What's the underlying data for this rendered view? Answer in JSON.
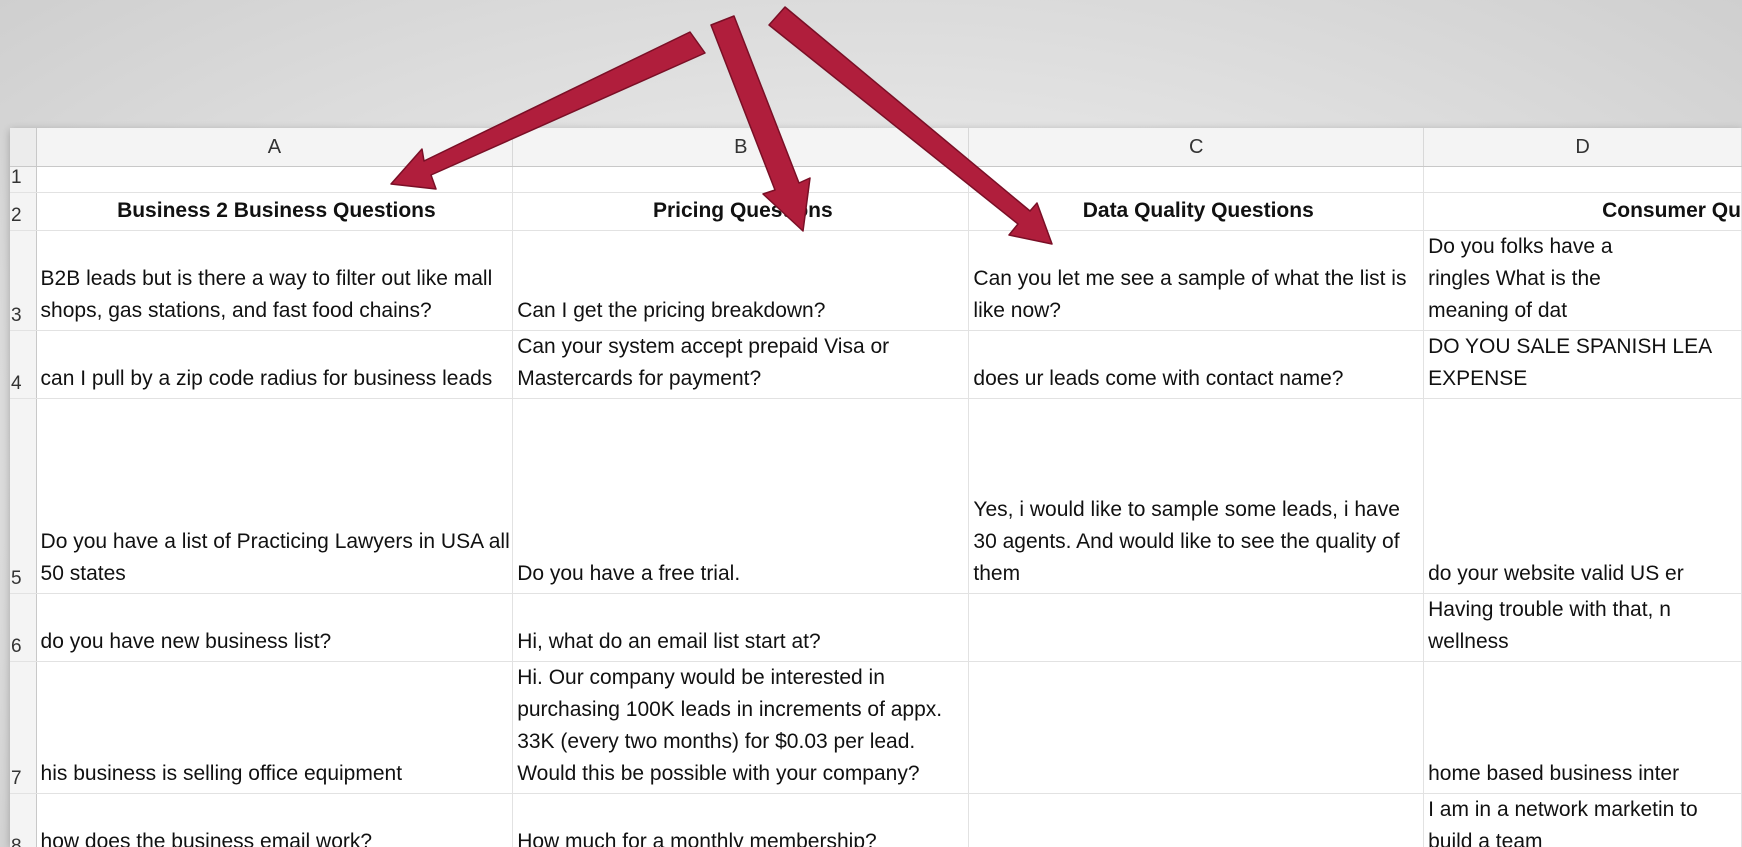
{
  "columns": [
    "A",
    "B",
    "C",
    "D"
  ],
  "rows": [
    {
      "num": "1",
      "cells": [
        "",
        "",
        "",
        ""
      ]
    },
    {
      "num": "2",
      "cells": [
        "Business 2 Business Questions",
        "Pricing Questions",
        "Data Quality Questions",
        "Consumer Qu"
      ]
    },
    {
      "num": "3",
      "cells": [
        "B2B leads but is there a way to filter out like mall shops, gas stations, and fast food chains?",
        "Can I get the pricing breakdown?",
        "Can you let me see a sample of what the list is like now?",
        "Do you folks have a ringles What is the meaning of dat"
      ]
    },
    {
      "num": "4",
      "cells": [
        "can I pull by a zip code radius for business leads",
        "Can your system accept prepaid Visa or Mastercards for payment?",
        "does ur leads come with contact name?",
        "DO YOU SALE SPANISH LEA EXPENSE"
      ]
    },
    {
      "num": "5",
      "cells": [
        "Do you have a list of Practicing Lawyers in USA all 50 states",
        "Do you have a free trial.",
        "Yes, i would like to sample some leads, i have 30 agents. And would like to see the quality of them",
        "do your website valid US er"
      ]
    },
    {
      "num": "6",
      "cells": [
        "do you have new business list?",
        "Hi, what do an email list start at?",
        "",
        "Having trouble with that, n wellness"
      ]
    },
    {
      "num": "7",
      "cells": [
        "his business is selling office equipment",
        "Hi.  Our company would be interested in purchasing 100K leads in increments of appx. 33K (every two months) for $0.03 per lead. Would this be possible with your company?",
        "",
        "home based business inter"
      ]
    },
    {
      "num": "8",
      "cells": [
        "how does the business email work?",
        "How much for a monthly membership?",
        "",
        "I am in a network marketin to build a team"
      ]
    }
  ],
  "colors": {
    "arrow": "#b01e3c",
    "arrow_edge": "#7a0f26"
  }
}
